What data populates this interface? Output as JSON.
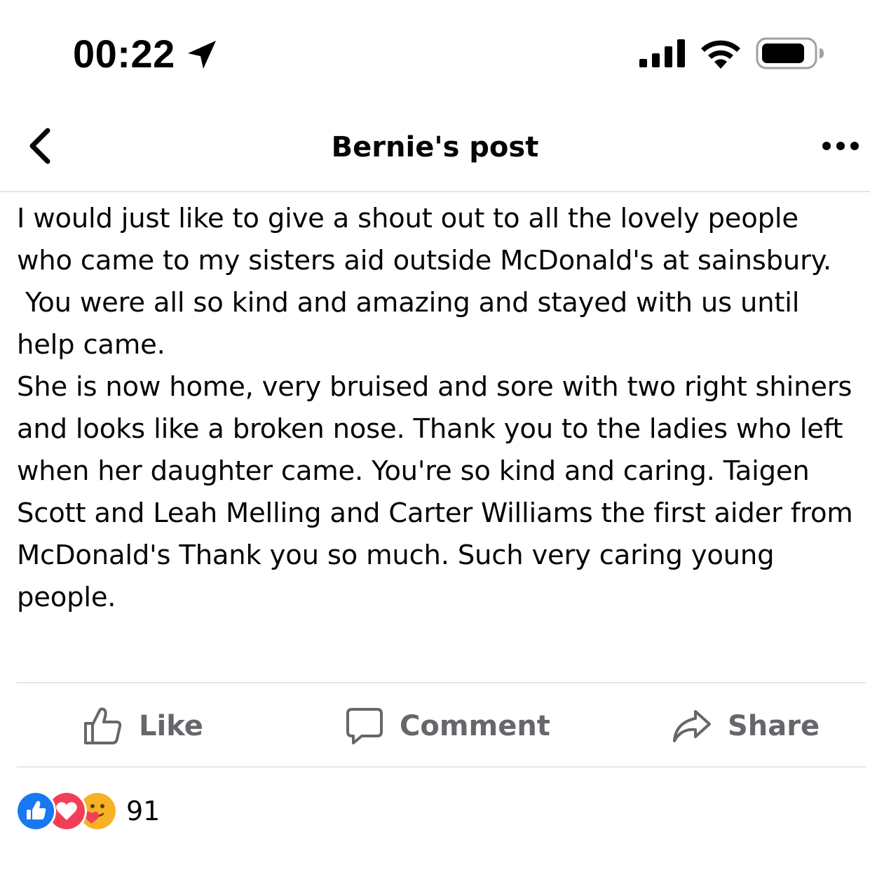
{
  "status_bar": {
    "time": "00:22",
    "icons": [
      "location-arrow-icon",
      "cellular-signal-icon",
      "wifi-icon",
      "battery-icon"
    ]
  },
  "header": {
    "title": "Bernie's post",
    "back_icon": "chevron-left-icon",
    "more_icon": "more-dots-icon"
  },
  "post": {
    "text": "I would just like to give a shout out to all the lovely people who came to my sisters aid outside McDonald's at sainsbury.\n You were all so kind and amazing and stayed with us until help came.\nShe is now home, very bruised and sore with two right shiners and looks like a broken nose. Thank you to the ladies who left when her daughter came. You're so kind and caring. Taigen Scott and Leah Melling and Carter Williams the first aider from McDonald's Thank you so much. Such very caring young people."
  },
  "actions": {
    "like_label": "Like",
    "comment_label": "Comment",
    "share_label": "Share"
  },
  "reactions": {
    "types": [
      "like-reaction-icon",
      "love-reaction-icon",
      "care-reaction-icon"
    ],
    "count": "91"
  },
  "colors": {
    "text": "#050505",
    "secondary_text": "#65676b",
    "divider": "#e4e6eb",
    "like_blue": "#1877f2",
    "love_red": "#f33e58",
    "care_yellow": "#f7b125"
  }
}
